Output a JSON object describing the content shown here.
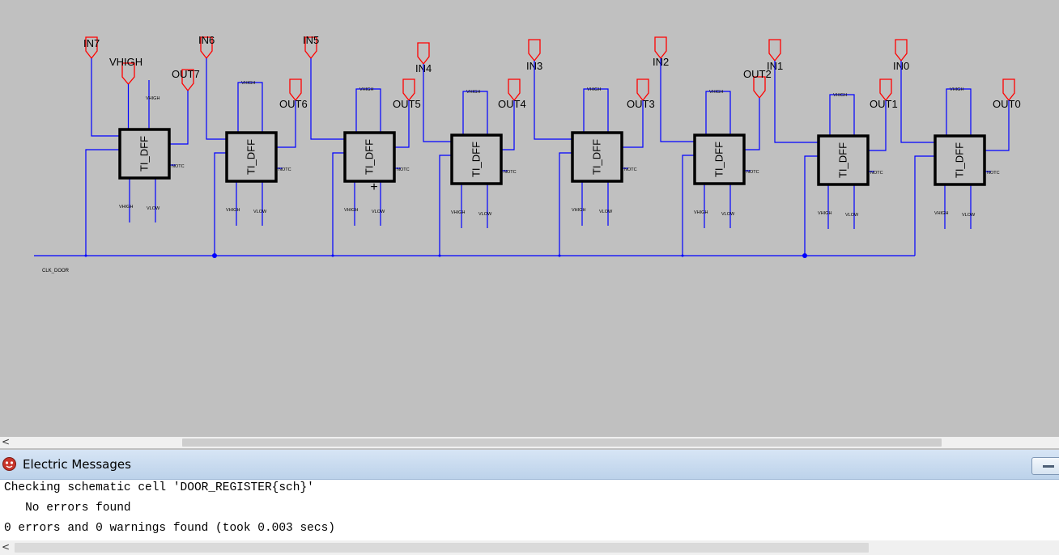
{
  "schematic": {
    "cell_label": "TI_DFF",
    "port_labels": {
      "vhigh_small": "VHIGH",
      "vlow_small": "VLOW",
      "notc_small": "NOTC"
    },
    "clock_net_label": "CLK_DOOR",
    "exports": {
      "in7": "IN7",
      "in6": "IN6",
      "in5": "IN5",
      "in4": "IN4",
      "in3": "IN3",
      "in2": "IN2",
      "in1": "IN1",
      "in0": "IN0",
      "out7": "OUT7",
      "out6": "OUT6",
      "out5": "OUT5",
      "out4": "OUT4",
      "out3": "OUT3",
      "out2": "OUT2",
      "out1": "OUT1",
      "out0": "OUT0",
      "vhigh": "VHIGH"
    },
    "colors": {
      "wire": "#0000ff",
      "export": "#ff0000",
      "cell_border": "#000000",
      "background": "#c0c0c0"
    }
  },
  "messages": {
    "window_title": "Electric Messages",
    "lines": [
      "Checking schematic cell 'DOOR_REGISTER{sch}'",
      "   No errors found",
      "0 errors and 0 warnings found (took 0.003 secs)"
    ]
  },
  "scrollbar": {
    "left_arrow": "<"
  }
}
